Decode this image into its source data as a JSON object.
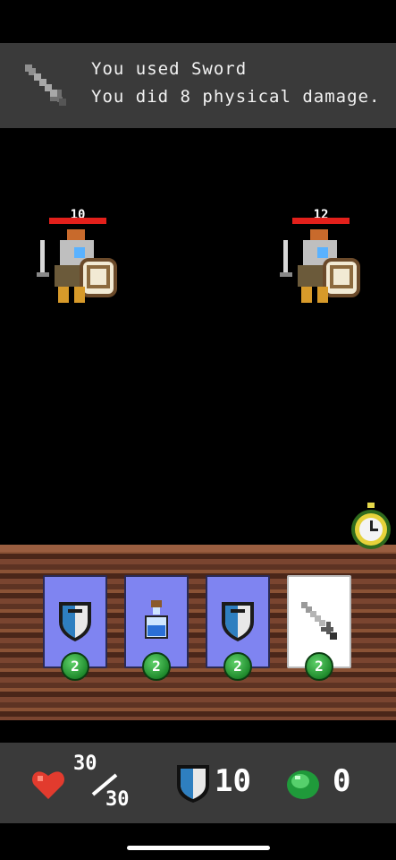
{
  "log": {
    "line1": "You used Sword",
    "line2": "You did 8 physical damage.",
    "icon": "sword-icon"
  },
  "enemies": [
    {
      "hp": "10",
      "hp_fraction": 1.0
    },
    {
      "hp": "12",
      "hp_fraction": 1.0
    }
  ],
  "hand": [
    {
      "art": "shield-icon",
      "cost": "2",
      "selected": false
    },
    {
      "art": "potion-icon",
      "cost": "2",
      "selected": false
    },
    {
      "art": "shield-icon",
      "cost": "2",
      "selected": false
    },
    {
      "art": "sword-icon",
      "cost": "2",
      "selected": true
    }
  ],
  "player": {
    "hp_current": "30",
    "hp_max": "30",
    "armor": "10",
    "gems": "0"
  },
  "colors": {
    "card_blue": "#7f84f1",
    "hp_red": "#e3201b",
    "banner_gray": "#3a3a3a"
  }
}
